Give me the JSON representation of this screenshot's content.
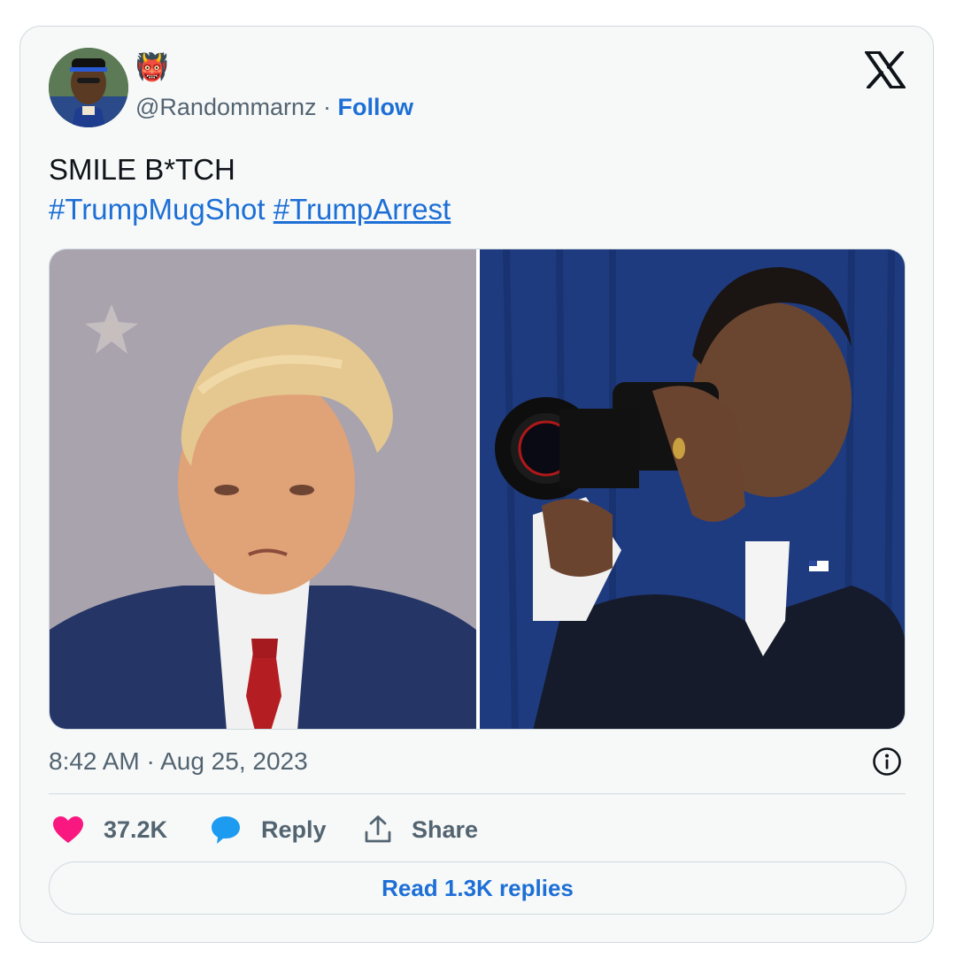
{
  "author": {
    "emoji": "👹",
    "handle": "@Randommarnz",
    "separator": " · ",
    "follow_label": "Follow"
  },
  "tweet": {
    "text": "SMILE B*TCH",
    "hashtags": [
      "#TrumpMugShot",
      "#TrumpArrest"
    ]
  },
  "media": [
    {
      "description_name": "mugshot-photo"
    },
    {
      "description_name": "camera-photo"
    }
  ],
  "timestamp": "8:42 AM · Aug 25, 2023",
  "actions": {
    "like_count": "37.2K",
    "reply_label": "Reply",
    "share_label": "Share"
  },
  "read_replies_label": "Read 1.3K replies",
  "colors": {
    "link": "#1d6fd6",
    "like": "#f91880",
    "reply": "#1d9bf0",
    "secondary_text": "#536471"
  },
  "icons": {
    "platform": "x-logo-icon",
    "info": "info-icon",
    "like": "heart-icon",
    "reply": "speech-bubble-icon",
    "share": "share-upload-icon"
  }
}
